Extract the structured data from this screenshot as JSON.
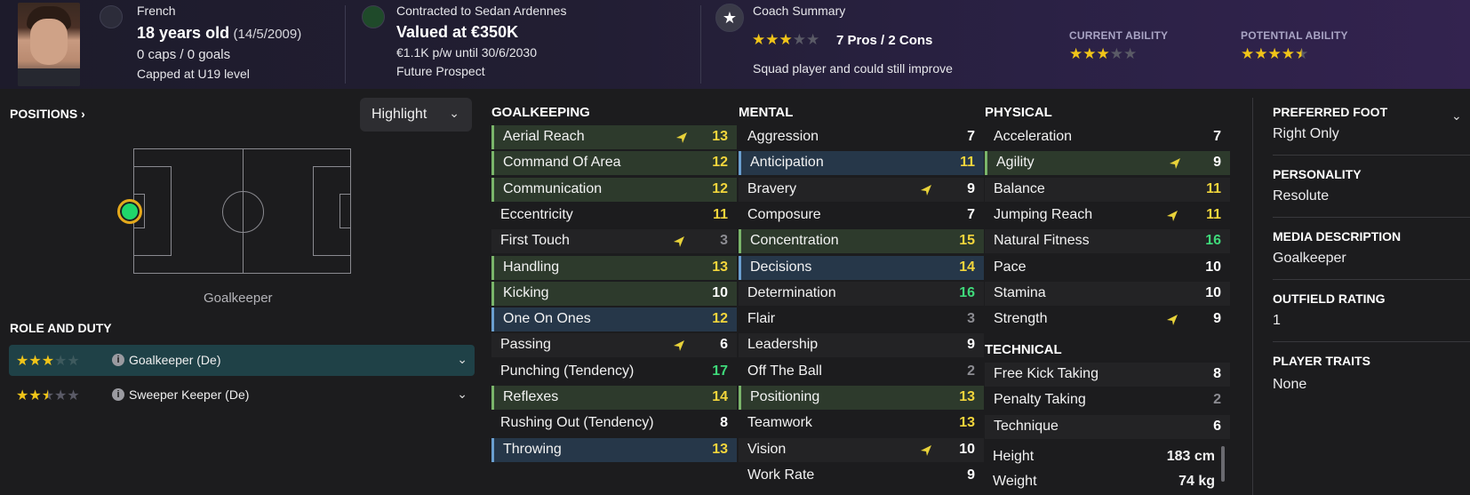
{
  "header": {
    "nationality": "French",
    "age": "18 years old",
    "dob": "(14/5/2009)",
    "caps_goals": "0 caps / 0 goals",
    "capped_level": "Capped at U19 level",
    "contract": "Contracted to Sedan Ardennes",
    "value": "Valued at €350K",
    "wage": "€1.1K p/w until 30/6/2030",
    "prospect": "Future Prospect",
    "coach_title": "Coach Summary",
    "pros_cons": "7 Pros / 2 Cons",
    "coach_note": "Squad player and could still improve",
    "coach_stars": 3,
    "current_ability_label": "CURRENT ABILITY",
    "current_ability_stars": 3,
    "potential_ability_label": "POTENTIAL ABILITY",
    "potential_ability_stars": 4.5
  },
  "positions": {
    "title": "POSITIONS",
    "highlight_label": "Highlight",
    "position_name": "Goalkeeper"
  },
  "role_duty": {
    "title": "ROLE AND DUTY",
    "roles": [
      {
        "label": "Goalkeeper (De)",
        "stars": 3,
        "active": true
      },
      {
        "label": "Sweeper Keeper (De)",
        "stars": 2.5,
        "active": false
      }
    ]
  },
  "attributes": {
    "goalkeeping": {
      "title": "GOALKEEPING",
      "items": [
        {
          "name": "Aerial Reach",
          "value": "13",
          "arrow": true
        },
        {
          "name": "Command Of Area",
          "value": "12"
        },
        {
          "name": "Communication",
          "value": "12"
        },
        {
          "name": "Eccentricity",
          "value": "11"
        },
        {
          "name": "First Touch",
          "value": "3",
          "arrow": true
        },
        {
          "name": "Handling",
          "value": "13"
        },
        {
          "name": "Kicking",
          "value": "10"
        },
        {
          "name": "One On Ones",
          "value": "12"
        },
        {
          "name": "Passing",
          "value": "6",
          "arrow": true
        },
        {
          "name": "Punching (Tendency)",
          "value": "17"
        },
        {
          "name": "Reflexes",
          "value": "14"
        },
        {
          "name": "Rushing Out (Tendency)",
          "value": "8"
        },
        {
          "name": "Throwing",
          "value": "13"
        }
      ]
    },
    "mental": {
      "title": "MENTAL",
      "items": [
        {
          "name": "Aggression",
          "value": "7"
        },
        {
          "name": "Anticipation",
          "value": "11"
        },
        {
          "name": "Bravery",
          "value": "9",
          "arrow": true
        },
        {
          "name": "Composure",
          "value": "7"
        },
        {
          "name": "Concentration",
          "value": "15"
        },
        {
          "name": "Decisions",
          "value": "14"
        },
        {
          "name": "Determination",
          "value": "16"
        },
        {
          "name": "Flair",
          "value": "3"
        },
        {
          "name": "Leadership",
          "value": "9"
        },
        {
          "name": "Off The Ball",
          "value": "2"
        },
        {
          "name": "Positioning",
          "value": "13"
        },
        {
          "name": "Teamwork",
          "value": "13"
        },
        {
          "name": "Vision",
          "value": "10",
          "arrow": true
        },
        {
          "name": "Work Rate",
          "value": "9"
        }
      ]
    },
    "physical": {
      "title": "PHYSICAL",
      "items": [
        {
          "name": "Acceleration",
          "value": "7"
        },
        {
          "name": "Agility",
          "value": "9",
          "arrow": true
        },
        {
          "name": "Balance",
          "value": "11"
        },
        {
          "name": "Jumping Reach",
          "value": "11",
          "arrow": true
        },
        {
          "name": "Natural Fitness",
          "value": "16"
        },
        {
          "name": "Pace",
          "value": "10"
        },
        {
          "name": "Stamina",
          "value": "10"
        },
        {
          "name": "Strength",
          "value": "9",
          "arrow": true
        }
      ]
    },
    "technical": {
      "title": "TECHNICAL",
      "items": [
        {
          "name": "Free Kick Taking",
          "value": "8"
        },
        {
          "name": "Penalty Taking",
          "value": "2"
        },
        {
          "name": "Technique",
          "value": "6"
        }
      ]
    },
    "height_label": "Height",
    "height": "183 cm",
    "weight_label": "Weight",
    "weight": "74 kg"
  },
  "profile": {
    "preferred_foot_title": "PREFERRED FOOT",
    "preferred_foot": "Right Only",
    "personality_title": "PERSONALITY",
    "personality": "Resolute",
    "media_title": "MEDIA DESCRIPTION",
    "media": "Goalkeeper",
    "outfield_title": "OUTFIELD RATING",
    "outfield": "1",
    "traits_title": "PLAYER TRAITS",
    "traits": "None"
  },
  "colors": {
    "highlight_green": "#7ab56a",
    "highlight_blue": "#6a9fd0",
    "value_yellow": "#f2d53c",
    "value_green": "#3fd97a",
    "star": "#f0c419",
    "role_active_bg": "#1f4147"
  }
}
